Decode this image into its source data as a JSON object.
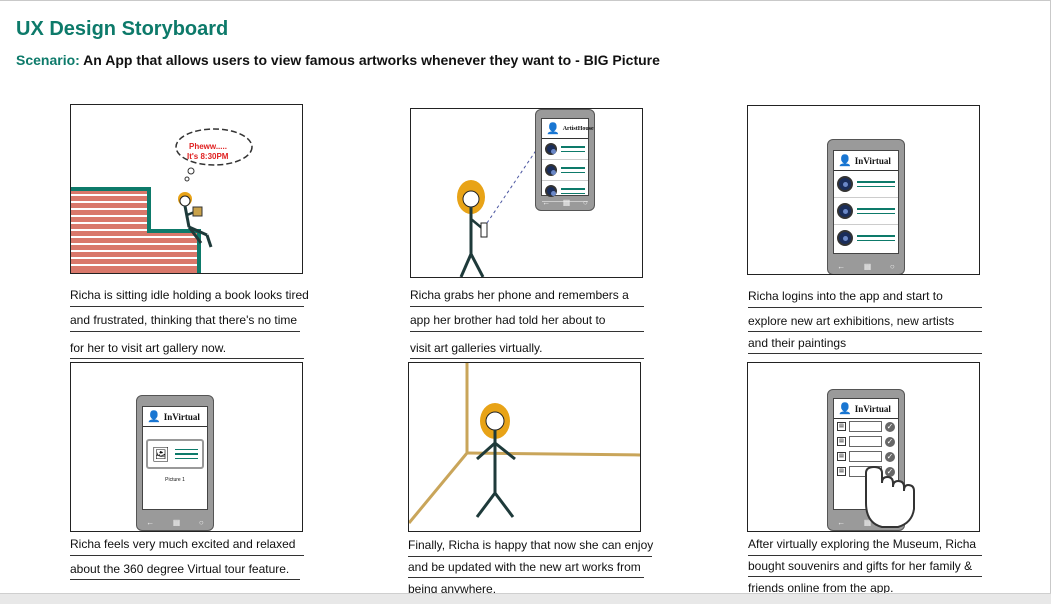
{
  "header": {
    "title": "UX Design Storyboard",
    "scenario_label": "Scenario:",
    "scenario_text": " An App that allows users to view famous artworks whenever they want to - BIG Picture"
  },
  "panels": [
    {
      "caption_lines": [
        "Richa is sitting idle holding a book looks tired",
        "and frustrated, thinking that there's no time",
        "for her to visit art gallery now."
      ],
      "thought_lines": [
        "Pheww.....",
        "It's 8:30PM"
      ]
    },
    {
      "caption_lines": [
        "Richa grabs her phone and remembers a",
        "app her brother had told her about to",
        "visit art galleries virtually."
      ],
      "app_name": "ArtistHouse"
    },
    {
      "caption_lines": [
        "Richa logins into the app and start to",
        "explore new art exhibitions, new artists",
        "and their paintings"
      ],
      "app_name": "InVirtual"
    },
    {
      "caption_lines": [
        "Richa feels very much excited and relaxed",
        "about the 360 degree Virtual tour feature."
      ],
      "app_name": "InVirtual",
      "picture_label": "Picture 1"
    },
    {
      "caption_lines": [
        "Finally, Richa is happy that now she can enjoy",
        "and be updated with the new art works from",
        "being anywhere."
      ]
    },
    {
      "caption_lines": [
        "After virtually exploring the Museum, Richa",
        "bought souvenirs and gifts for her family &",
        "friends online from the app."
      ],
      "app_name": "InVirtual"
    }
  ],
  "colors": {
    "accent": "#0d7a6a",
    "hair": "#e8a317",
    "stairs": "#d9786b",
    "thought_text": "#e02020"
  },
  "icons": [
    "user-icon",
    "picture-icon",
    "hand-cursor-icon",
    "check-icon",
    "back-icon",
    "windows-icon",
    "search-icon"
  ]
}
